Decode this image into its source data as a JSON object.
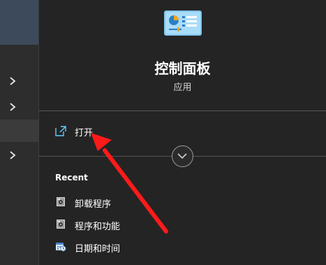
{
  "app": {
    "title": "控制面板",
    "type": "应用",
    "icon": "control-panel-icon"
  },
  "actions": {
    "open_label": "打开",
    "open_icon": "open-external-icon",
    "expand_icon": "chevron-down-icon"
  },
  "recent": {
    "heading": "Recent",
    "items": [
      {
        "label": "卸载程序",
        "icon": "programs-icon"
      },
      {
        "label": "程序和功能",
        "icon": "programs-icon"
      },
      {
        "label": "日期和时间",
        "icon": "calendar-clock-icon"
      }
    ]
  },
  "left_panel": {
    "chevron_icon": "chevron-right-icon"
  },
  "annotation": {
    "color": "#ff1a1a"
  },
  "colors": {
    "pane_bg": "#242424",
    "left_bg": "#2d2d2d",
    "selection": "#3c4a5b",
    "accent": "#60cdff"
  }
}
